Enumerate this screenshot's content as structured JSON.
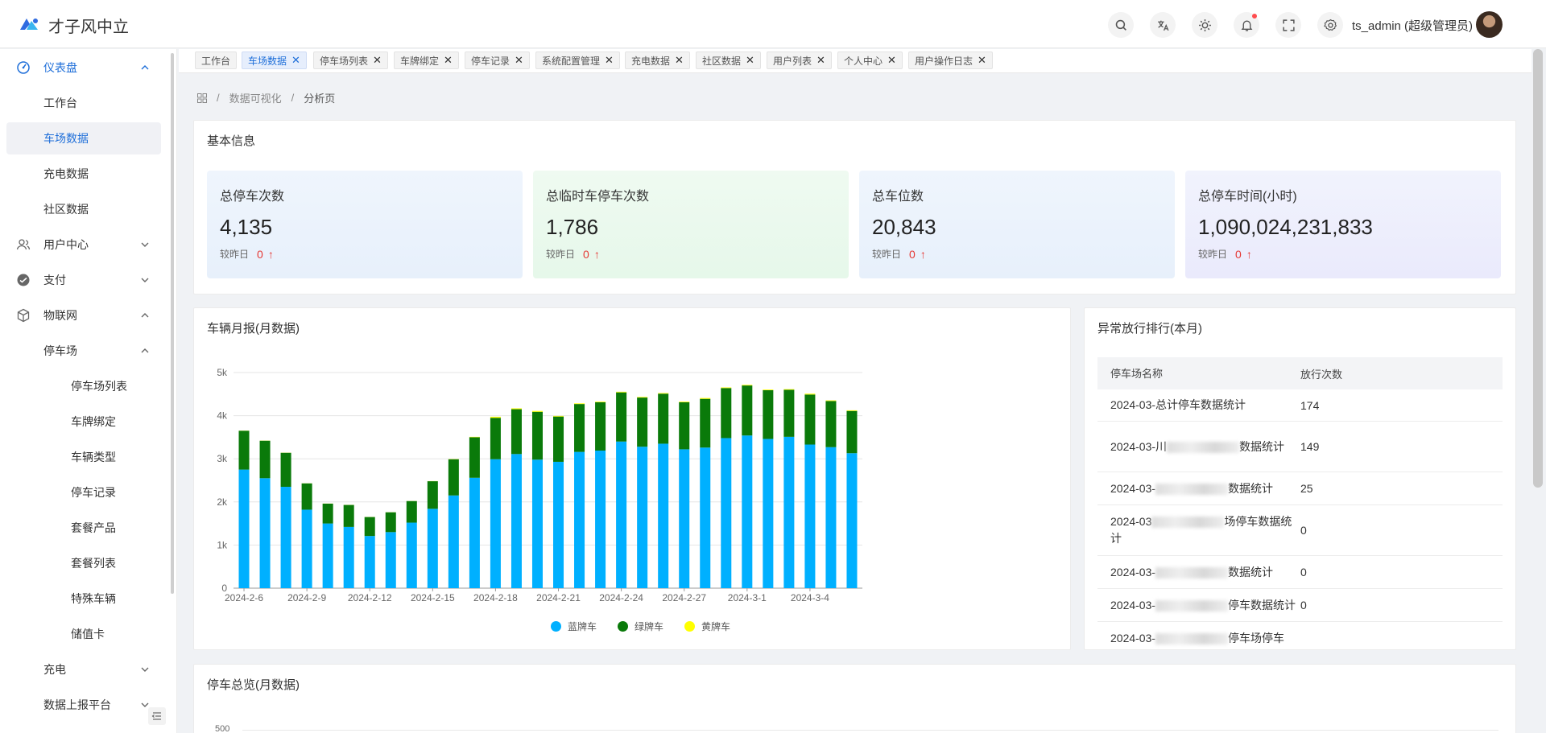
{
  "app": {
    "title": "才子风中立",
    "user": "ts_admin (超级管理员)"
  },
  "colors": {
    "accent": "#1f6fd9",
    "blue_plate": "#00b0ff",
    "green_plate": "#0a7a0a",
    "yellow_plate": "#ffff00"
  },
  "header_icons": [
    "search-icon",
    "translate-icon",
    "theme-icon",
    "bell-icon",
    "fullscreen-icon",
    "settings-icon"
  ],
  "sidebar": {
    "items": [
      {
        "label": "仪表盘",
        "icon": "dashboard-icon",
        "expanded": true
      },
      {
        "label": "工作台"
      },
      {
        "label": "车场数据",
        "active": true
      },
      {
        "label": "充电数据"
      },
      {
        "label": "社区数据"
      },
      {
        "label": "用户中心",
        "icon": "users-icon"
      },
      {
        "label": "支付",
        "icon": "payment-icon"
      },
      {
        "label": "物联网",
        "icon": "iot-icon",
        "expanded": true
      },
      {
        "label": "停车场",
        "expanded": true
      },
      {
        "label": "停车场列表"
      },
      {
        "label": "车牌绑定"
      },
      {
        "label": "车辆类型"
      },
      {
        "label": "停车记录"
      },
      {
        "label": "套餐产品"
      },
      {
        "label": "套餐列表"
      },
      {
        "label": "特殊车辆"
      },
      {
        "label": "储值卡"
      },
      {
        "label": "充电"
      },
      {
        "label": "数据上报平台"
      }
    ]
  },
  "tabs": [
    {
      "label": "工作台"
    },
    {
      "label": "车场数据",
      "active": true
    },
    {
      "label": "停车场列表"
    },
    {
      "label": "车牌绑定"
    },
    {
      "label": "停车记录"
    },
    {
      "label": "系统配置管理"
    },
    {
      "label": "充电数据"
    },
    {
      "label": "社区数据"
    },
    {
      "label": "用户列表"
    },
    {
      "label": "个人中心"
    },
    {
      "label": "用户操作日志"
    }
  ],
  "breadcrumb": {
    "items": [
      "数据可视化",
      "分析页"
    ]
  },
  "basic_info": {
    "title": "基本信息",
    "stats": [
      {
        "label": "总停车次数",
        "value": "4,135",
        "compare_label": "较昨日",
        "delta": "0"
      },
      {
        "label": "总临时车停车次数",
        "value": "1,786",
        "compare_label": "较昨日",
        "delta": "0"
      },
      {
        "label": "总车位数",
        "value": "20,843",
        "compare_label": "较昨日",
        "delta": "0"
      },
      {
        "label": "总停车时间(小时)",
        "value": "1,090,024,231,833",
        "compare_label": "较昨日",
        "delta": "0"
      }
    ]
  },
  "monthly_chart": {
    "title": "车辆月报(月数据)",
    "legend": [
      "蓝牌车",
      "绿牌车",
      "黄牌车"
    ]
  },
  "chart_data": {
    "type": "bar",
    "stacked": true,
    "title": "车辆月报(月数据)",
    "ylim": [
      0,
      5000
    ],
    "yticks": [
      "0",
      "1k",
      "2k",
      "3k",
      "4k",
      "5k"
    ],
    "categories": [
      "2024-2-6",
      "2024-2-7",
      "2024-2-8",
      "2024-2-9",
      "2024-2-10",
      "2024-2-11",
      "2024-2-12",
      "2024-2-13",
      "2024-2-14",
      "2024-2-15",
      "2024-2-16",
      "2024-2-17",
      "2024-2-18",
      "2024-2-19",
      "2024-2-20",
      "2024-2-21",
      "2024-2-22",
      "2024-2-23",
      "2024-2-24",
      "2024-2-25",
      "2024-2-26",
      "2024-2-27",
      "2024-2-28",
      "2024-2-29",
      "2024-3-1",
      "2024-3-2",
      "2024-3-3",
      "2024-3-4",
      "2024-3-5",
      "2024-3-6"
    ],
    "x_tick_labels": [
      "2024-2-6",
      "2024-2-9",
      "2024-2-12",
      "2024-2-15",
      "2024-2-18",
      "2024-2-21",
      "2024-2-24",
      "2024-2-27",
      "2024-3-1",
      "2024-3-4"
    ],
    "series": [
      {
        "name": "蓝牌车",
        "values": [
          2750,
          2550,
          2350,
          1820,
          1500,
          1420,
          1210,
          1300,
          1520,
          1840,
          2150,
          2560,
          2990,
          3110,
          2980,
          2930,
          3160,
          3190,
          3400,
          3280,
          3350,
          3220,
          3260,
          3480,
          3540,
          3460,
          3510,
          3330,
          3270,
          3130
        ]
      },
      {
        "name": "绿牌车",
        "values": [
          900,
          870,
          790,
          610,
          460,
          510,
          440,
          460,
          500,
          640,
          840,
          940,
          960,
          1040,
          1110,
          1050,
          1110,
          1120,
          1140,
          1140,
          1160,
          1090,
          1130,
          1160,
          1160,
          1130,
          1090,
          1160,
          1070,
          980
        ]
      },
      {
        "name": "黄牌车",
        "values": [
          3,
          3,
          3,
          2,
          2,
          2,
          2,
          2,
          2,
          3,
          5,
          10,
          25,
          20,
          20,
          15,
          15,
          15,
          15,
          15,
          15,
          15,
          20,
          15,
          15,
          15,
          15,
          20,
          15,
          15
        ]
      }
    ]
  },
  "ranking": {
    "title": "异常放行排行(本月)",
    "columns": [
      "停车场名称",
      "放行次数"
    ],
    "rows": [
      {
        "name_pre": "2024-03-总计停车数据统计",
        "name_post": "",
        "count": "174"
      },
      {
        "name_pre": "2024-03-川",
        "name_post": "数据统计",
        "count": "149"
      },
      {
        "name_pre": "2024-03-",
        "name_post": "数据统计",
        "count": "25"
      },
      {
        "name_pre": "2024-03",
        "name_post": "场停车数据统计",
        "count": "0"
      },
      {
        "name_pre": "2024-03-",
        "name_post": "数据统计",
        "count": "0"
      },
      {
        "name_pre": "2024-03-",
        "name_post": "停车数据统计",
        "count": "0"
      },
      {
        "name_pre": "2024-03-",
        "name_post": "停车场停车",
        "count": ""
      }
    ]
  },
  "overview": {
    "title": "停车总览(月数据)",
    "first_tick": "500"
  }
}
